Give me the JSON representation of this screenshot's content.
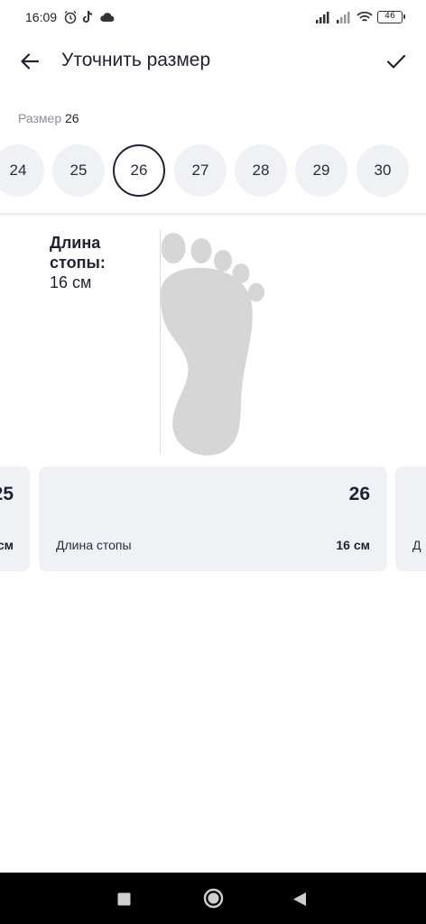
{
  "status_bar": {
    "time": "16:09",
    "battery": "46"
  },
  "app_bar": {
    "title": "Уточнить размер"
  },
  "size_selector": {
    "caption": "Размер",
    "selected": "26",
    "sizes": [
      "24",
      "25",
      "26",
      "27",
      "28",
      "29",
      "30"
    ]
  },
  "foot": {
    "title": "Длина стопы:",
    "value": "16 см"
  },
  "cards": {
    "prev": {
      "size": "25",
      "value": "см"
    },
    "current": {
      "size": "26",
      "label": "Длина стопы",
      "value": "16 см"
    },
    "next": {
      "label": "Д"
    }
  },
  "icons": {
    "back": "arrow-left-icon",
    "confirm": "check-icon",
    "nav_recent": "square-icon",
    "nav_home": "circle-icon",
    "nav_back": "triangle-icon"
  },
  "colors": {
    "chip_bg": "#f0f1f5",
    "text": "#1f2233",
    "muted": "#8c8f9e",
    "foot": "#d6d6d6"
  }
}
